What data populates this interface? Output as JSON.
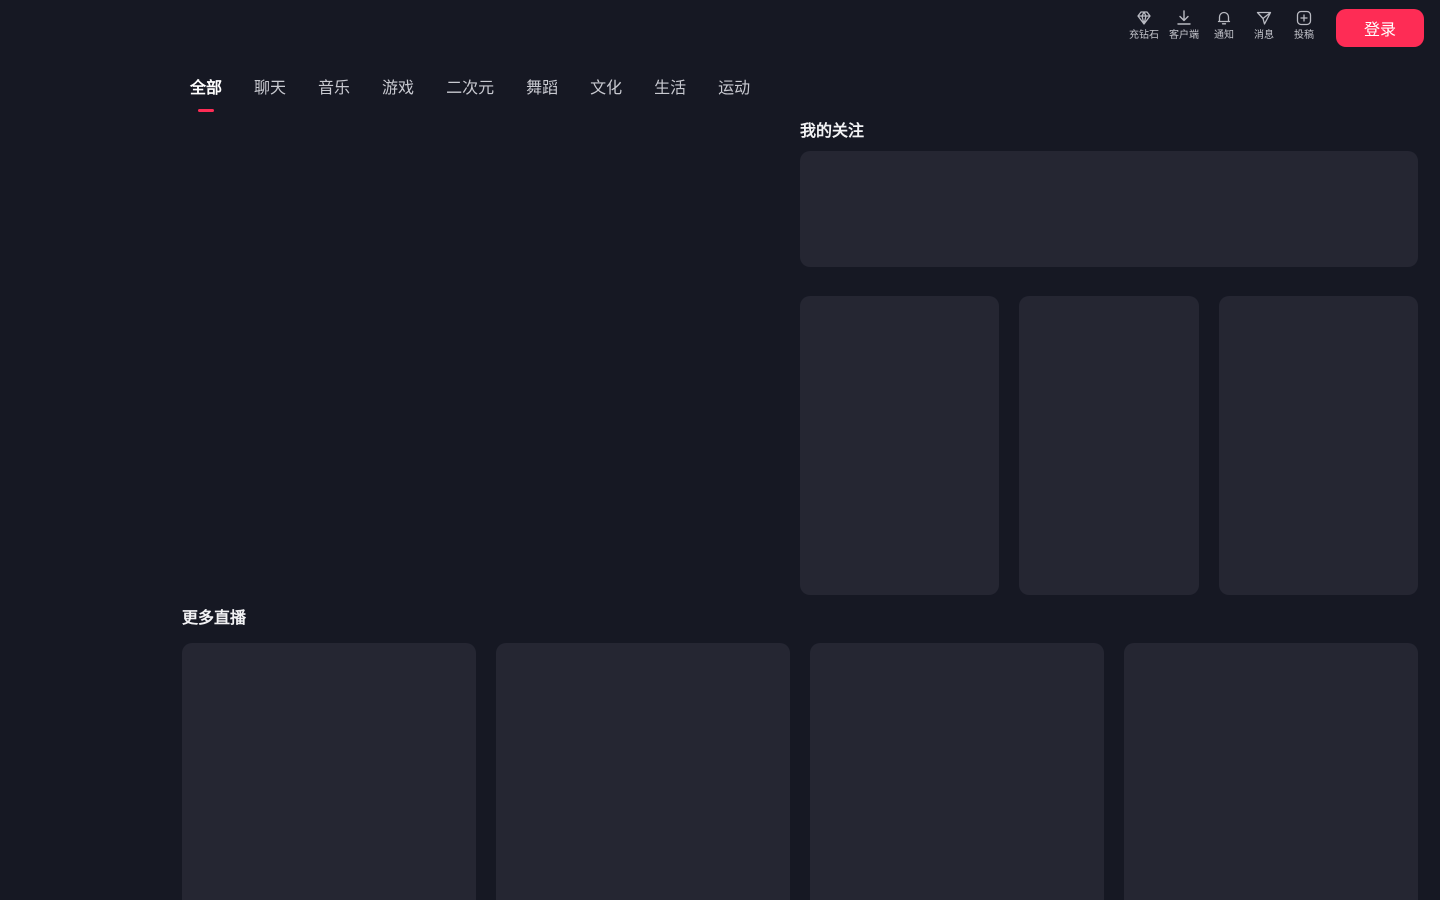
{
  "header": {
    "tools": [
      {
        "label": "充钻石",
        "icon": "diamond-icon"
      },
      {
        "label": "客户端",
        "icon": "download-icon"
      },
      {
        "label": "通知",
        "icon": "bell-icon"
      },
      {
        "label": "消息",
        "icon": "send-icon"
      },
      {
        "label": "投稿",
        "icon": "plus-square-icon"
      }
    ],
    "login_label": "登录"
  },
  "categories": [
    {
      "label": "全部",
      "active": true
    },
    {
      "label": "聊天"
    },
    {
      "label": "音乐"
    },
    {
      "label": "游戏"
    },
    {
      "label": "二次元"
    },
    {
      "label": "舞蹈"
    },
    {
      "label": "文化"
    },
    {
      "label": "生活"
    },
    {
      "label": "运动"
    }
  ],
  "following": {
    "title": "我的关注"
  },
  "more_live": {
    "title": "更多直播"
  },
  "colors": {
    "background": "#161823",
    "card": "#252632",
    "accent": "#fe2c55"
  }
}
